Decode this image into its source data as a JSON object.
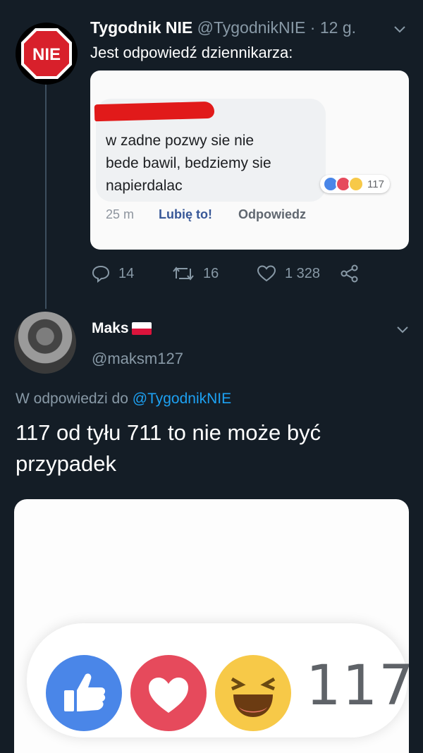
{
  "tweet1": {
    "name": "Tygodnik NIE",
    "handle": "@TygodnikNIE",
    "separator": "·",
    "time": "12 g.",
    "text": "Jest odpowiedź dziennikarza:",
    "avatar_text": "NIE",
    "quote": {
      "comment_lines": [
        "w zadne pozwy sie nie",
        "bede bawil, bedziemy sie",
        "napierdalac"
      ],
      "reactions_count": "117",
      "comment_time": "25 m",
      "like_label": "Lubię to!",
      "reply_label": "Odpowiedz"
    },
    "actions": {
      "replies": "14",
      "retweets": "16",
      "likes": "1 328"
    }
  },
  "tweet2": {
    "name": "Maks",
    "handle": "@maksm127",
    "reply_prefix": "W odpowiedzi do",
    "reply_to": "@TygodnikNIE",
    "text": "117 od tyłu 711 to nie może być przypadek",
    "image": {
      "reactions_count": "117"
    }
  },
  "colors": {
    "background": "#141d26",
    "muted": "#8899a6",
    "link": "#1da1f2",
    "fb_like_blue": "#4a86e8",
    "fb_love_red": "#e64a5c",
    "fb_haha_yellow": "#f7c948"
  },
  "icons": {
    "reply": "reply-icon",
    "retweet": "retweet-icon",
    "like": "heart-icon",
    "share": "share-icon",
    "menu": "chevron-down-icon",
    "flag": "poland-flag-icon"
  }
}
